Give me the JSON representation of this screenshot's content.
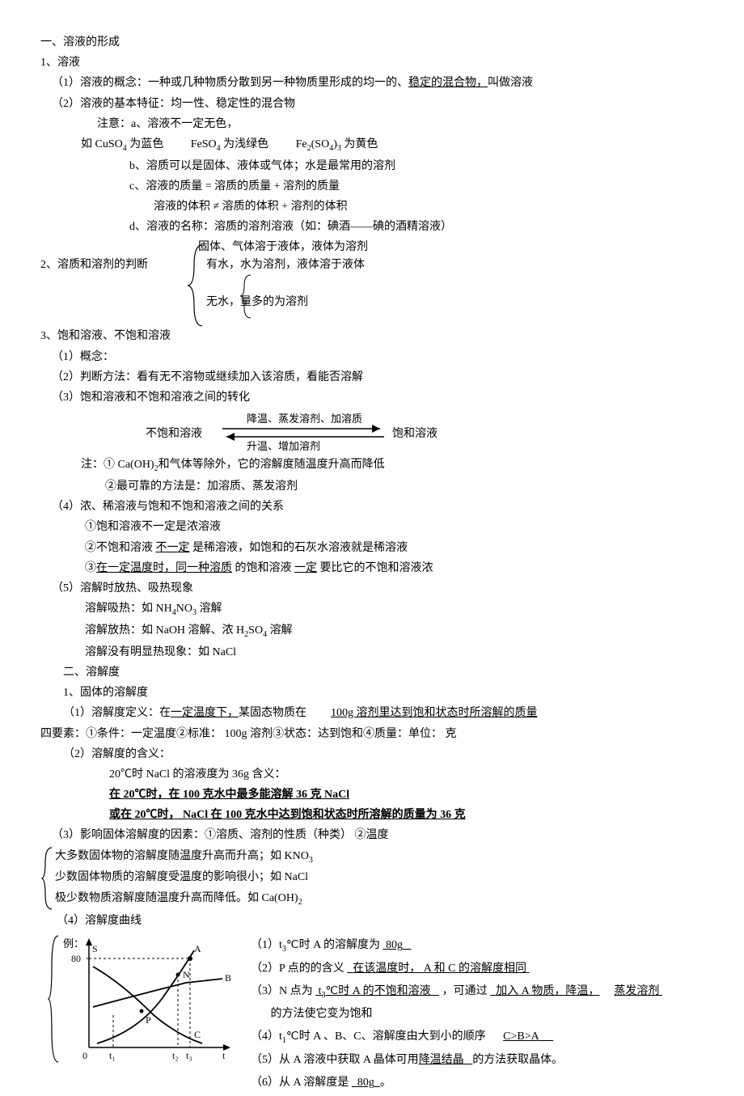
{
  "h1": "一、溶液的形成",
  "s1": "1、溶液",
  "s1_1a": "（1）溶液的概念：一种或几种物质分散到另一种物质里形成的均一的、",
  "s1_1b": "稳定的混合物，",
  "s1_1c": "叫做溶液",
  "s1_2": "（2）溶液的基本特征：均一性、稳定性的混合物",
  "note_a": "注意：a、溶液不一定无色，",
  "note_a2a": "如 CuSO",
  "note_a2b": "为蓝色",
  "note_a2c": "FeSO",
  "note_a2d": "为浅绿色",
  "note_a2e": "Fe",
  "note_a2f": "(SO",
  "note_a2g": ")",
  "note_a2h": "为黄色",
  "note_b": "b、溶质可以是固体、液体或气体；水是最常用的溶剂",
  "note_c": "c、溶液的质量  =  溶质的质量   +  溶剂的质量",
  "note_c2": "溶液的体积   ≠   溶质的体积   +  溶剂的体积",
  "note_d": "d、溶液的名称：溶质的溶剂溶液（如：碘酒——碘的酒精溶液）",
  "s2_pre": "固体、气体溶于液体，液体为溶剂",
  "s2": "2、溶质和溶剂的判断",
  "s2_b1": "有水，水为溶剂，液体溶于液体",
  "s2_b2": "无水，量多的为溶剂",
  "s3": "3、饱和溶液、不饱和溶液",
  "s3_1": "（1）概念：",
  "s3_2": "（2）判断方法：看有无不溶物或继续加入该溶质，看能否溶解",
  "s3_3": "（3）饱和溶液和不饱和溶液之间的转化",
  "arrow_left": "不饱和溶液",
  "arrow_top": "降温、蒸发溶剂、加溶质",
  "arrow_bot": "升温、增加溶剂",
  "arrow_right": "饱和溶液",
  "s3_note1a": "注：① Ca(OH)",
  "s3_note1b": "和气体等除外，它的溶解度随温度升高而降低",
  "s3_note2": "②最可靠的方法是：加溶质、蒸发溶剂",
  "s3_4": "（4）浓、稀溶液与饱和不饱和溶液之间的关系",
  "s3_4_1": "①饱和溶液不一定是浓溶液",
  "s3_4_2a": "②不饱和溶液",
  "s3_4_2b": "不一定",
  "s3_4_2c": "是稀溶液，如饱和的石灰水溶液就是稀溶液",
  "s3_4_3a": "③",
  "s3_4_3b": "在一定温度时，同一种溶质",
  "s3_4_3c": "的饱和溶液",
  "s3_4_3d": "一定",
  "s3_4_3e": "要比它的不饱和溶液浓",
  "s3_5": "（5）溶解时放热、吸热现象",
  "s3_5_1a": "溶解吸热：如   NH",
  "s3_5_1b": "NO",
  "s3_5_1c": "溶解",
  "s3_5_2a": "溶解放热：如   NaOH 溶解、浓   H",
  "s3_5_2b": "SO",
  "s3_5_2c": "溶解",
  "s3_5_3": "溶解没有明显热现象：如     NaCl",
  "h2": "二、溶解度",
  "p1": "1、固体的溶解度",
  "p1_1a": "（1）溶解度定义：在",
  "p1_1b": "一定温度下，",
  "p1_1c": "某固态物质在",
  "p1_1d": "100g 溶剂里达到饱和状态时所溶解的质量",
  "p1_note": "四要素：①条件：一定温度②标准：    100g 溶剂③状态：达到饱和④质量：单位：   克",
  "p1_2": "（2）溶解度的含义：",
  "p1_2_1": "20℃时 NaCl 的溶液度为   36g 含义：",
  "p1_2_2": "在 20℃时，在   100 克水中最多能溶解    36 克 NaCl",
  "p1_2_3": "或在 20℃时， NaCl 在 100 克水中达到饱和状态时所溶解的质量为     36 克",
  "p1_3": "（3）影响固体溶解度的因素：①溶质、溶剂的性质（种类）         ②温度",
  "p1_3_1": "大多数固体物的溶解度随温度升高而升高；如      KNO",
  "p1_3_2": "少数固体物质的溶解度受温度的影响很小；如      NaCl",
  "p1_3_3": "极少数物质溶解度随温度升高而降低。如      Ca(OH)",
  "p1_4": "（4）溶解度曲线",
  "ex": "例：",
  "y80": "80",
  "lblS": "S",
  "lblA": "A",
  "lblN": "N",
  "lblB": "B",
  "lblP": "P",
  "lblC": "C",
  "t0": "0",
  "t1": "t₁",
  "t2": "t₂",
  "t3": "t₃",
  "tt": "t",
  "q1a": "（1）t",
  "q1b": "℃时  A 的溶解度为",
  "q1c": "80g",
  "q2a": "（2）P 点的的含义",
  "q2b": "在该温度时，  A 和 C 的溶解度相同",
  "q3a": "（3）N 点为",
  "q3b": "t",
  "q3c": "℃时  A 的不饱和溶液",
  "q3d": "，可通过",
  "q3e": "加入 A 物质，降温，",
  "q3f": "蒸发溶剂",
  "q3g": "的方法使它变为饱和",
  "q4a": "（4）t",
  "q4b": "℃时 A 、B、C、溶解度由大到小的顺序",
  "q4c": "C>B>A",
  "q5a": "（5）从 A 溶液中获取   A 晶体可用",
  "q5b": "降温结晶",
  "q5c": "的方法获取晶体。",
  "q6a": "（6）从 A 溶解度是",
  "q6b": "80g",
  "q6c": "。"
}
